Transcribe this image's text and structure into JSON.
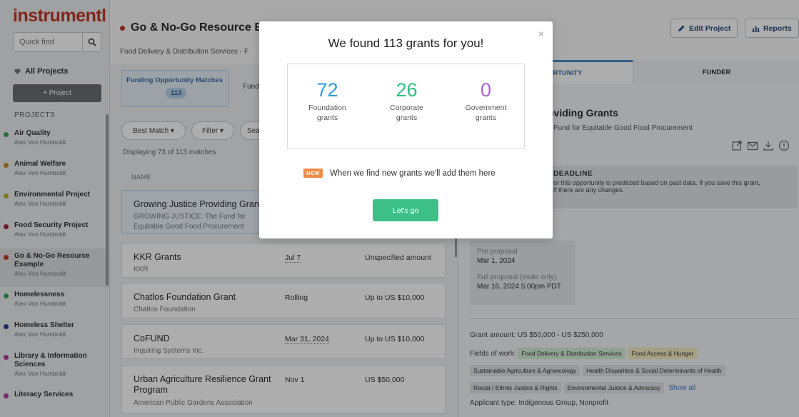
{
  "app": {
    "logo": "instrumentl"
  },
  "sidebar": {
    "quickfind_placeholder": "Quick find",
    "all_projects": "All Projects",
    "add_project": "+ Project",
    "projects_heading": "PROJECTS",
    "projects": [
      {
        "name": "Air Quality",
        "owner": "Alex Von Humboldt",
        "color": "#3ba55c",
        "active": false
      },
      {
        "name": "Animal Welfare",
        "owner": "Alex Von Humboldt",
        "color": "#c98a2c",
        "active": false
      },
      {
        "name": "Environmental Project",
        "owner": "Alex Von Humboldt",
        "color": "#b6b534",
        "active": false
      },
      {
        "name": "Food Security Project",
        "owner": "Alex Von Humboldt",
        "color": "#a3243b",
        "active": false
      },
      {
        "name": "Go & No-Go Resource Example",
        "owner": "Alex Von Humboldt",
        "color": "#c0392b",
        "active": true
      },
      {
        "name": "Homelessness",
        "owner": "Alex Von Humboldt",
        "color": "#3ba55c",
        "active": false
      },
      {
        "name": "Homeless Shelter",
        "owner": "Alex Von Humboldt",
        "color": "#2c3e9b",
        "active": false
      },
      {
        "name": "Library & Information Sciences",
        "owner": "Alex Von Humboldt",
        "color": "#b23aa0",
        "active": false
      },
      {
        "name": "Literacy Services",
        "owner": "",
        "color": "#b23aa0",
        "active": false
      }
    ]
  },
  "header": {
    "project_title": "Go & No-Go Resource Exa",
    "project_subtitle": "Food Delivery & Distribution Services - F",
    "edit_project": "Edit Project",
    "reports": "Reports"
  },
  "list": {
    "tab_matches": "Funding Opportunity Matches",
    "tab_matches_count": "113",
    "tab_other": "Fund",
    "filters": {
      "best_match": "Best Match ▾",
      "filter": "Filter ▾",
      "search": "Sear"
    },
    "displaying": "Displaying 73 of 113 matches",
    "col_name": "NAME",
    "grants": [
      {
        "name": "Growing Justice Providing Grant",
        "funder": "GROWING JUSTICE: The Fund for Equitable Good Food Procurement",
        "date": "",
        "amount": ""
      },
      {
        "name": "KKR Grants",
        "funder": "KKR",
        "date": "Jul 7",
        "amount": "Unspecified amount"
      },
      {
        "name": "Chatlos Foundation Grant",
        "funder": "Chatlos Foundation",
        "date": "Rolling",
        "amount": "Up to US $10,000"
      },
      {
        "name": "CoFUND",
        "funder": "Inquiring Systems Inc.",
        "date": "Mar 31, 2024",
        "amount": "Up to US $10,000"
      },
      {
        "name": "Urban Agriculture Resilience Grant Program",
        "funder": "American Public Gardens Association",
        "date": "Nov 1",
        "amount": "US $50,000"
      }
    ]
  },
  "detail": {
    "tab_opportunity": "ORTUNITY",
    "tab_funder": "FUNDER",
    "title": "oviding Grants",
    "subtitle": "e Fund for Equitable Good Food Procurement",
    "deadline_heading": "DEADLINE",
    "deadline_line1": "or this opportunity is predicted based on past data. If you save this grant,",
    "deadline_line2": "if there are any changes.",
    "pre_proposal_label": "Pre proposal",
    "pre_proposal_date": "Mar 1, 2024",
    "full_proposal_label": "Full proposal (invite only)",
    "full_proposal_date": "Mar 16, 2024 5:00pm PDT",
    "grant_amount": "Grant amount: US $50,000 - US $250,000",
    "fields_label": "Fields of work:",
    "tags": [
      {
        "text": "Food Delivery & Distribution Services",
        "style": "g"
      },
      {
        "text": "Food Access & Hunger",
        "style": "y"
      },
      {
        "text": "Sustainable Agriculture & Agroecology",
        "style": "gr"
      },
      {
        "text": "Health Disparities & Social Determinants of Health",
        "style": "gr"
      },
      {
        "text": "Racial / Ethnic Justice & Rights",
        "style": "gr"
      },
      {
        "text": "Environmental Justice & Advocacy",
        "style": "gr"
      }
    ],
    "show_all": "Show all",
    "applicant": "Applicant type: Indigenous Group, Nonprofit"
  },
  "modal": {
    "title": "We found 113 grants for you!",
    "close": "×",
    "stats": [
      {
        "num": "72",
        "label1": "Foundation",
        "label2": "grants",
        "color": "#2e9be0"
      },
      {
        "num": "26",
        "label1": "Corporate",
        "label2": "grants",
        "color": "#2fbf81"
      },
      {
        "num": "0",
        "label1": "Government",
        "label2": "grants",
        "color": "#a964d6"
      }
    ],
    "new_tag": "NEW",
    "new_text": "When we find new grants we'll add them here",
    "cta": "Let's go"
  }
}
